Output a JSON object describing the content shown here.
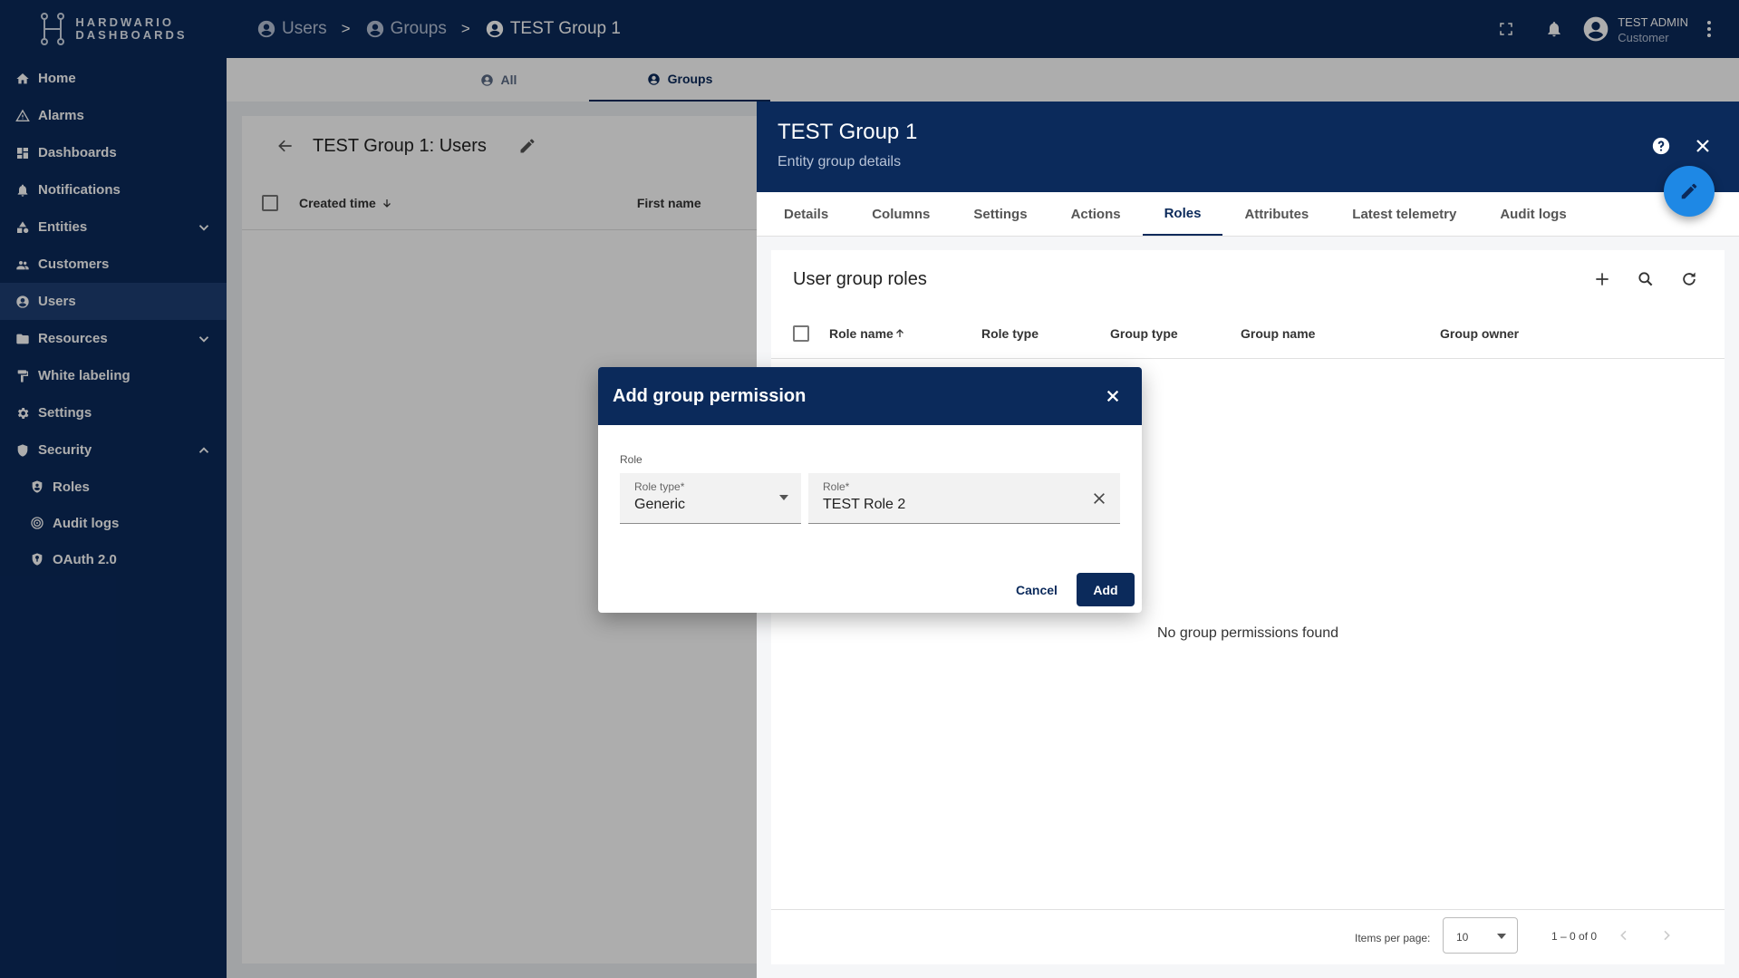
{
  "app": {
    "logo_line1": "HARDWARIO",
    "logo_line2": "DASHBOARDS"
  },
  "sidebar": {
    "items": [
      {
        "label": "Home",
        "icon": "home-icon"
      },
      {
        "label": "Alarms",
        "icon": "alert-triangle-icon"
      },
      {
        "label": "Dashboards",
        "icon": "dashboard-grid-icon"
      },
      {
        "label": "Notifications",
        "icon": "bell-ring-icon"
      },
      {
        "label": "Entities",
        "icon": "shapes-icon",
        "expandable": true
      },
      {
        "label": "Customers",
        "icon": "people-icon"
      },
      {
        "label": "Users",
        "icon": "account-circle-icon",
        "active": true
      },
      {
        "label": "Resources",
        "icon": "folder-icon",
        "expandable": true
      },
      {
        "label": "White labeling",
        "icon": "paint-roller-icon"
      },
      {
        "label": "Settings",
        "icon": "gear-icon"
      },
      {
        "label": "Security",
        "icon": "shield-icon",
        "expanded": true
      },
      {
        "label": "Roles",
        "icon": "shield-account-icon",
        "sub": true
      },
      {
        "label": "Audit logs",
        "icon": "audit-icon",
        "sub": true
      },
      {
        "label": "OAuth 2.0",
        "icon": "security-key-icon",
        "sub": true
      }
    ]
  },
  "header": {
    "breadcrumb": [
      {
        "label": "Users"
      },
      {
        "label": "Groups"
      },
      {
        "label": "TEST Group 1"
      }
    ],
    "separator": ">",
    "user_name": "TEST ADMIN",
    "user_role": "Customer"
  },
  "top_tabs": [
    {
      "label": "All"
    },
    {
      "label": "Groups",
      "active": true
    }
  ],
  "left_card": {
    "title": "TEST Group 1: Users",
    "columns": [
      "Created time",
      "First name"
    ]
  },
  "panel": {
    "title": "TEST Group 1",
    "subtitle": "Entity group details",
    "tabs": [
      "Details",
      "Columns",
      "Settings",
      "Actions",
      "Roles",
      "Attributes",
      "Latest telemetry",
      "Audit logs"
    ],
    "active_tab": "Roles",
    "roles_card": {
      "title": "User group roles",
      "columns": [
        "Role name",
        "Role type",
        "Group type",
        "Group name",
        "Group owner"
      ],
      "empty_text": "No group permissions found",
      "items_per_page_label": "Items per page:",
      "items_per_page": "10",
      "range": "1 – 0 of 0"
    }
  },
  "dialog": {
    "title": "Add group permission",
    "section_label": "Role",
    "role_type_label": "Role type*",
    "role_type_value": "Generic",
    "role_label": "Role*",
    "role_value": "TEST Role 2",
    "cancel_label": "Cancel",
    "add_label": "Add"
  },
  "colors": {
    "primary": "#0b2a5b",
    "fab": "#1e88e5",
    "active_nav": "#1e3f73"
  }
}
